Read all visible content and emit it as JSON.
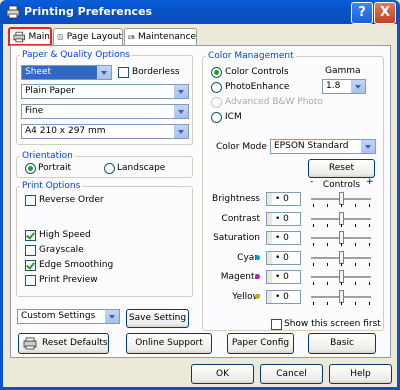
{
  "window": {
    "title": "Printing Preferences",
    "help_label": "?",
    "close_label": "X"
  },
  "tabs": [
    {
      "label": "Main",
      "active": true
    },
    {
      "label": "Page Layout",
      "active": false
    },
    {
      "label": "Maintenance",
      "active": false
    }
  ],
  "paper_quality": {
    "legend": "Paper & Quality Options",
    "source": "Sheet",
    "borderless_label": "Borderless",
    "borderless_checked": false,
    "media_type": "Plain Paper",
    "quality": "Fine",
    "paper_size": "A4 210 x 297 mm"
  },
  "orientation": {
    "legend": "Orientation",
    "portrait_label": "Portrait",
    "landscape_label": "Landscape",
    "selected": "Portrait"
  },
  "print_options": {
    "legend": "Print Options",
    "items": [
      {
        "label": "Reverse Order",
        "checked": false
      },
      {
        "label": "High Speed",
        "checked": true
      },
      {
        "label": "Grayscale",
        "checked": false
      },
      {
        "label": "Edge Smoothing",
        "checked": true
      },
      {
        "label": "Print Preview",
        "checked": false
      }
    ]
  },
  "color_management": {
    "legend": "Color Management",
    "color_controls_label": "Color Controls",
    "photoenhance_label": "PhotoEnhance",
    "advanced_bw_label": "Advanced B&W Photo",
    "icm_label": "ICM",
    "selected": "Color Controls",
    "gamma_label": "Gamma",
    "gamma_value": "1.8",
    "color_mode_label": "Color Mode",
    "color_mode_value": "EPSON Standard",
    "reset_controls_label": "Reset Controls",
    "adjustments": [
      {
        "label": "Brightness",
        "value": "0",
        "dot_color": ""
      },
      {
        "label": "Contrast",
        "value": "0",
        "dot_color": ""
      },
      {
        "label": "Saturation",
        "value": "0",
        "dot_color": ""
      },
      {
        "label": "Cyan",
        "value": "0",
        "dot_color": "#00A0E0"
      },
      {
        "label": "Magenta",
        "value": "0",
        "dot_color": "#C020C0"
      },
      {
        "label": "Yellow",
        "value": "0",
        "dot_color": "#C8B000"
      }
    ],
    "show_screen_label": "Show this screen first",
    "show_screen_checked": false
  },
  "footer": {
    "custom_settings": "Custom Settings",
    "save_setting_label": "Save Setting",
    "reset_defaults_label": "Reset Defaults",
    "online_support_label": "Online Support",
    "paper_config_label": "Paper Config",
    "basic_label": "Basic"
  },
  "dialog_buttons": {
    "ok": "OK",
    "cancel": "Cancel",
    "help": "Help"
  }
}
